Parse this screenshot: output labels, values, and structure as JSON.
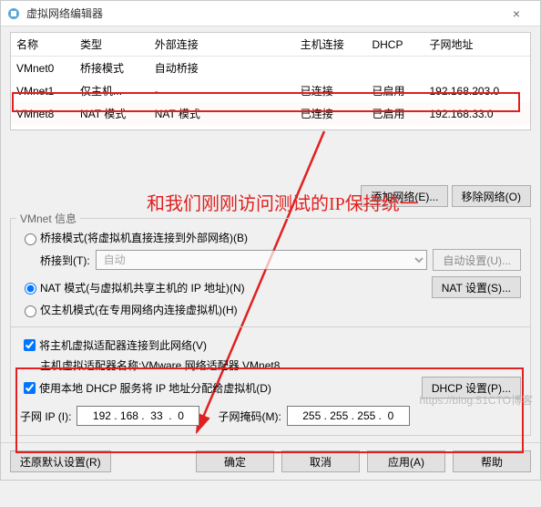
{
  "window": {
    "title": "虚拟网络编辑器",
    "close_icon": "×"
  },
  "table": {
    "headers": [
      "名称",
      "类型",
      "外部连接",
      "主机连接",
      "DHCP",
      "子网地址"
    ],
    "rows": [
      {
        "name": "VMnet0",
        "type": "桥接模式",
        "ext": "自动桥接",
        "host": "",
        "dhcp": "",
        "subnet": ""
      },
      {
        "name": "VMnet1",
        "type": "仅主机...",
        "ext": "-",
        "host": "已连接",
        "dhcp": "已启用",
        "subnet": "192.168.203.0"
      },
      {
        "name": "VMnet8",
        "type": "NAT 模式",
        "ext": "NAT 模式",
        "host": "已连接",
        "dhcp": "已启用",
        "subnet": "192.168.33.0"
      }
    ]
  },
  "annotation": "和我们刚刚访问测试的IP保持统一",
  "buttons": {
    "add_net": "添加网络(E)...",
    "remove_net": "移除网络(O)",
    "auto_setting": "自动设置(U)...",
    "nat_setting": "NAT 设置(S)...",
    "dhcp_setting": "DHCP 设置(P)...",
    "restore": "还原默认设置(R)",
    "ok": "确定",
    "cancel": "取消",
    "apply": "应用(A)",
    "help": "帮助"
  },
  "group": {
    "label": "VMnet 信息",
    "opt_bridge": "桥接模式(将虚拟机直接连接到外部网络)(B)",
    "bridge_to": "桥接到(T):",
    "bridge_value": "自动",
    "opt_nat": "NAT 模式(与虚拟机共享主机的 IP 地址)(N)",
    "opt_host": "仅主机模式(在专用网络内连接虚拟机)(H)",
    "chk_hostadapter": "将主机虚拟适配器连接到此网络(V)",
    "hostadapter_name_label": "主机虚拟适配器名称: ",
    "hostadapter_name_value": "VMware 网络适配器 VMnet8",
    "chk_dhcp": "使用本地 DHCP 服务将 IP 地址分配给虚拟机(D)",
    "subnet_ip_label": "子网 IP (I):",
    "subnet_ip_value": "192 . 168 .  33  .  0",
    "subnet_mask_label": "子网掩码(M):",
    "subnet_mask_value": "255 . 255 . 255 .  0"
  },
  "watermark": "https://blog.51CTO博客"
}
